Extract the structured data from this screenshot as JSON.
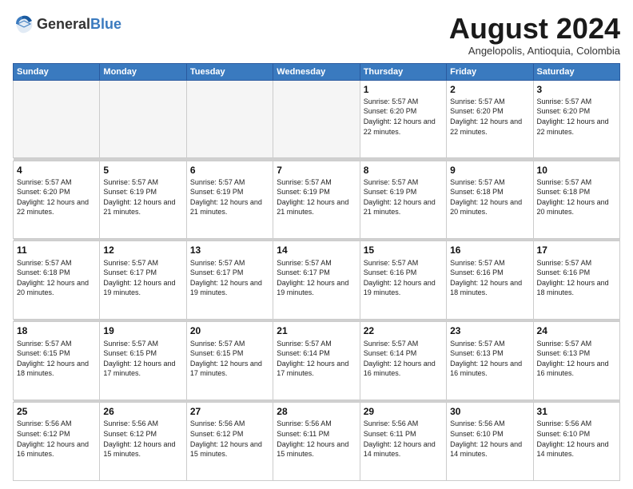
{
  "logo": {
    "general": "General",
    "blue": "Blue"
  },
  "header": {
    "month": "August 2024",
    "location": "Angelopolis, Antioquia, Colombia"
  },
  "days_of_week": [
    "Sunday",
    "Monday",
    "Tuesday",
    "Wednesday",
    "Thursday",
    "Friday",
    "Saturday"
  ],
  "weeks": [
    [
      {
        "day": "",
        "info": ""
      },
      {
        "day": "",
        "info": ""
      },
      {
        "day": "",
        "info": ""
      },
      {
        "day": "",
        "info": ""
      },
      {
        "day": "1",
        "info": "Sunrise: 5:57 AM\nSunset: 6:20 PM\nDaylight: 12 hours\nand 22 minutes."
      },
      {
        "day": "2",
        "info": "Sunrise: 5:57 AM\nSunset: 6:20 PM\nDaylight: 12 hours\nand 22 minutes."
      },
      {
        "day": "3",
        "info": "Sunrise: 5:57 AM\nSunset: 6:20 PM\nDaylight: 12 hours\nand 22 minutes."
      }
    ],
    [
      {
        "day": "4",
        "info": "Sunrise: 5:57 AM\nSunset: 6:20 PM\nDaylight: 12 hours\nand 22 minutes."
      },
      {
        "day": "5",
        "info": "Sunrise: 5:57 AM\nSunset: 6:19 PM\nDaylight: 12 hours\nand 21 minutes."
      },
      {
        "day": "6",
        "info": "Sunrise: 5:57 AM\nSunset: 6:19 PM\nDaylight: 12 hours\nand 21 minutes."
      },
      {
        "day": "7",
        "info": "Sunrise: 5:57 AM\nSunset: 6:19 PM\nDaylight: 12 hours\nand 21 minutes."
      },
      {
        "day": "8",
        "info": "Sunrise: 5:57 AM\nSunset: 6:19 PM\nDaylight: 12 hours\nand 21 minutes."
      },
      {
        "day": "9",
        "info": "Sunrise: 5:57 AM\nSunset: 6:18 PM\nDaylight: 12 hours\nand 20 minutes."
      },
      {
        "day": "10",
        "info": "Sunrise: 5:57 AM\nSunset: 6:18 PM\nDaylight: 12 hours\nand 20 minutes."
      }
    ],
    [
      {
        "day": "11",
        "info": "Sunrise: 5:57 AM\nSunset: 6:18 PM\nDaylight: 12 hours\nand 20 minutes."
      },
      {
        "day": "12",
        "info": "Sunrise: 5:57 AM\nSunset: 6:17 PM\nDaylight: 12 hours\nand 19 minutes."
      },
      {
        "day": "13",
        "info": "Sunrise: 5:57 AM\nSunset: 6:17 PM\nDaylight: 12 hours\nand 19 minutes."
      },
      {
        "day": "14",
        "info": "Sunrise: 5:57 AM\nSunset: 6:17 PM\nDaylight: 12 hours\nand 19 minutes."
      },
      {
        "day": "15",
        "info": "Sunrise: 5:57 AM\nSunset: 6:16 PM\nDaylight: 12 hours\nand 19 minutes."
      },
      {
        "day": "16",
        "info": "Sunrise: 5:57 AM\nSunset: 6:16 PM\nDaylight: 12 hours\nand 18 minutes."
      },
      {
        "day": "17",
        "info": "Sunrise: 5:57 AM\nSunset: 6:16 PM\nDaylight: 12 hours\nand 18 minutes."
      }
    ],
    [
      {
        "day": "18",
        "info": "Sunrise: 5:57 AM\nSunset: 6:15 PM\nDaylight: 12 hours\nand 18 minutes."
      },
      {
        "day": "19",
        "info": "Sunrise: 5:57 AM\nSunset: 6:15 PM\nDaylight: 12 hours\nand 17 minutes."
      },
      {
        "day": "20",
        "info": "Sunrise: 5:57 AM\nSunset: 6:15 PM\nDaylight: 12 hours\nand 17 minutes."
      },
      {
        "day": "21",
        "info": "Sunrise: 5:57 AM\nSunset: 6:14 PM\nDaylight: 12 hours\nand 17 minutes."
      },
      {
        "day": "22",
        "info": "Sunrise: 5:57 AM\nSunset: 6:14 PM\nDaylight: 12 hours\nand 16 minutes."
      },
      {
        "day": "23",
        "info": "Sunrise: 5:57 AM\nSunset: 6:13 PM\nDaylight: 12 hours\nand 16 minutes."
      },
      {
        "day": "24",
        "info": "Sunrise: 5:57 AM\nSunset: 6:13 PM\nDaylight: 12 hours\nand 16 minutes."
      }
    ],
    [
      {
        "day": "25",
        "info": "Sunrise: 5:56 AM\nSunset: 6:12 PM\nDaylight: 12 hours\nand 16 minutes."
      },
      {
        "day": "26",
        "info": "Sunrise: 5:56 AM\nSunset: 6:12 PM\nDaylight: 12 hours\nand 15 minutes."
      },
      {
        "day": "27",
        "info": "Sunrise: 5:56 AM\nSunset: 6:12 PM\nDaylight: 12 hours\nand 15 minutes."
      },
      {
        "day": "28",
        "info": "Sunrise: 5:56 AM\nSunset: 6:11 PM\nDaylight: 12 hours\nand 15 minutes."
      },
      {
        "day": "29",
        "info": "Sunrise: 5:56 AM\nSunset: 6:11 PM\nDaylight: 12 hours\nand 14 minutes."
      },
      {
        "day": "30",
        "info": "Sunrise: 5:56 AM\nSunset: 6:10 PM\nDaylight: 12 hours\nand 14 minutes."
      },
      {
        "day": "31",
        "info": "Sunrise: 5:56 AM\nSunset: 6:10 PM\nDaylight: 12 hours\nand 14 minutes."
      }
    ]
  ]
}
